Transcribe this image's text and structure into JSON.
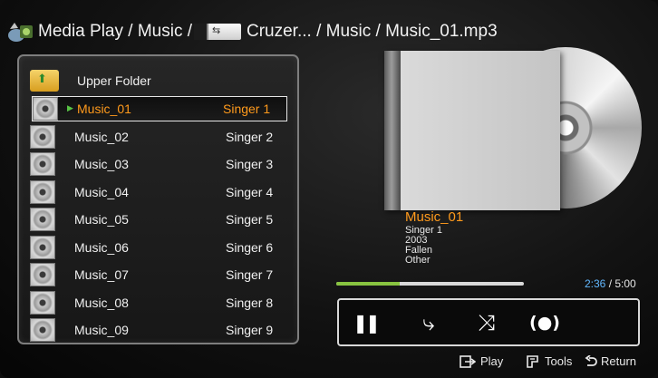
{
  "header": {
    "path_prefix": "Media Play / Music /",
    "device_label": "Cruzer... / Music / Music_01.mp3",
    "usb_glyph": "⇆"
  },
  "file_list": {
    "upper_folder_label": "Upper Folder",
    "items": [
      {
        "title": "Music_01",
        "artist": "Singer 1",
        "selected": true,
        "playing": true
      },
      {
        "title": "Music_02",
        "artist": "Singer 2"
      },
      {
        "title": "Music_03",
        "artist": "Singer 3"
      },
      {
        "title": "Music_04",
        "artist": "Singer 4"
      },
      {
        "title": "Music_05",
        "artist": "Singer 5"
      },
      {
        "title": "Music_06",
        "artist": "Singer 6"
      },
      {
        "title": "Music_07",
        "artist": "Singer 7"
      },
      {
        "title": "Music_08",
        "artist": "Singer 8"
      },
      {
        "title": "Music_09",
        "artist": "Singer 9"
      }
    ]
  },
  "now_playing": {
    "title": "Music_01",
    "artist": "Singer 1",
    "year": "2003",
    "album": "Fallen",
    "genre": "Other",
    "progress_fraction": 0.34,
    "current_time": "2:36",
    "separator": " / ",
    "total_time": "5:00"
  },
  "controls": {
    "pause_glyph": "❚❚",
    "repeat_glyph": "⤷",
    "shuffle_glyph": "⤨",
    "sound_glyph": "(●)"
  },
  "footer": {
    "play_label": "Play",
    "tools_label": "Tools",
    "return_label": "Return"
  },
  "colors": {
    "accent_orange": "#ff9a1c",
    "progress_green": "#88c440",
    "time_blue": "#62b8ff"
  }
}
